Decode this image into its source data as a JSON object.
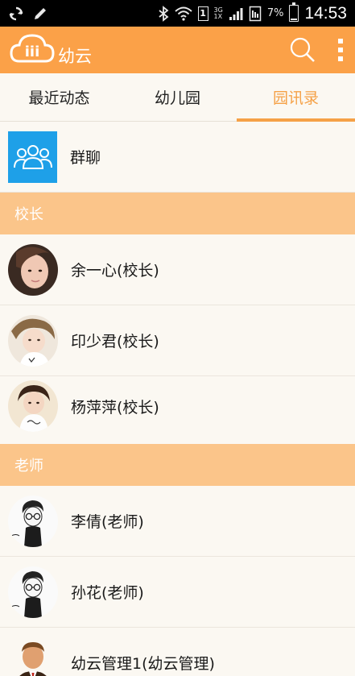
{
  "status_bar": {
    "battery_percent": "7%",
    "time": "14:53",
    "sim_label": "1",
    "network_top": "3G",
    "network_bottom": "1X"
  },
  "app_bar": {
    "logo_text": "iii",
    "title": "幼云",
    "icons": [
      "search-icon",
      "overflow-menu-icon"
    ]
  },
  "tabs": [
    {
      "label": "最近动态",
      "active": false
    },
    {
      "label": "幼儿园",
      "active": false
    },
    {
      "label": "园讯录",
      "active": true
    }
  ],
  "group_chat": {
    "label": "群聊",
    "icon": "group-icon"
  },
  "sections": [
    {
      "title": "校长",
      "members": [
        {
          "name": "余一心(校长)"
        },
        {
          "name": "印少君(校长)"
        },
        {
          "name": "杨萍萍(校长)"
        }
      ]
    },
    {
      "title": "老师",
      "members": [
        {
          "name": "李倩(老师)"
        },
        {
          "name": "孙花(老师)"
        },
        {
          "name": "幼云管理1(幼云管理)"
        }
      ]
    }
  ],
  "colors": {
    "accent": "#fba148",
    "active_tab": "#f5a147",
    "section_header": "#fbc58a",
    "group_icon_bg": "#1ea0e8"
  }
}
